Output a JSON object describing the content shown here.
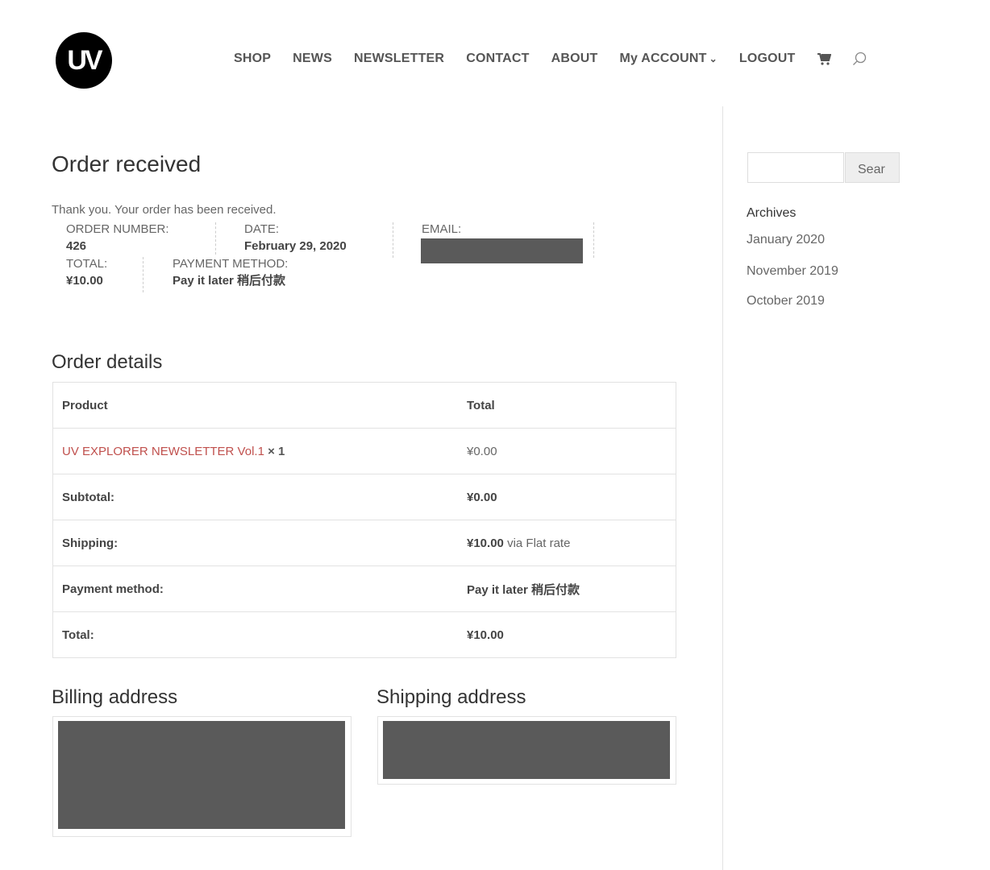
{
  "header": {
    "logo_text": "UV",
    "nav": {
      "shop": "SHOP",
      "news": "NEWS",
      "newsletter": "NEWSLETTER",
      "contact": "CONTACT",
      "about": "ABOUT",
      "my_account": "My ACCOUNT",
      "logout": "LOGOUT"
    },
    "icons": {
      "cart": "cart-icon",
      "search": "search-icon",
      "dropdown": "chevron-down-icon"
    }
  },
  "order": {
    "title": "Order received",
    "thanks": "Thank you. Your order has been received.",
    "number_label": "ORDER NUMBER:",
    "number_value": "426",
    "date_label": "DATE:",
    "date_value": "February 29, 2020",
    "email_label": "EMAIL:",
    "total_label": "TOTAL:",
    "total_value": "¥10.00",
    "payment_label": "PAYMENT METHOD:",
    "payment_value": "Pay it later 稍后付款"
  },
  "details": {
    "title": "Order details",
    "col_product": "Product",
    "col_total": "Total",
    "product_name": "UV EXPLORER NEWSLETTER Vol.1",
    "product_qty": "× 1",
    "product_total": "¥0.00",
    "subtotal_label": "Subtotal:",
    "subtotal_value": "¥0.00",
    "shipping_label": "Shipping:",
    "shipping_value": "¥10.00",
    "shipping_via": "via Flat rate",
    "payment_label": "Payment method:",
    "payment_value": "Pay it later 稍后付款",
    "total_label": "Total:",
    "total_value": "¥10.00"
  },
  "addresses": {
    "billing_title": "Billing address",
    "shipping_title": "Shipping address"
  },
  "sidebar": {
    "search_button": "Sear",
    "archives_title": "Archives",
    "archives": [
      "January 2020",
      "November 2019",
      "October 2019"
    ]
  },
  "colors": {
    "link": "#c0504d",
    "redaction": "#5a5a5a",
    "border": "#e2e2e2"
  }
}
